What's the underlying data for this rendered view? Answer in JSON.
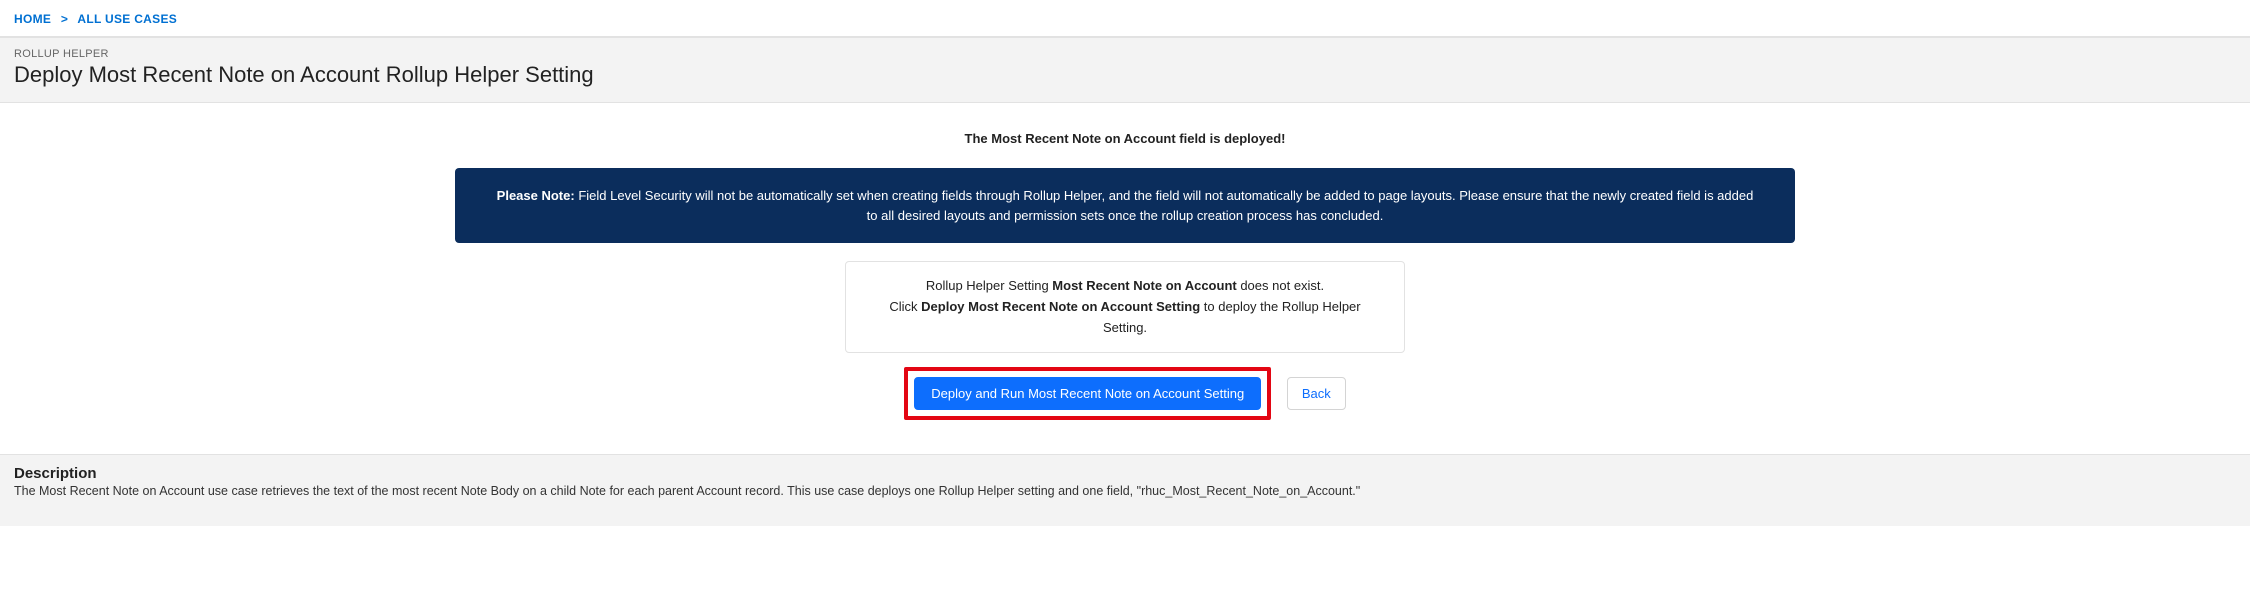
{
  "breadcrumb": {
    "home": "HOME",
    "sep": ">",
    "all": "ALL USE CASES"
  },
  "header": {
    "eyebrow": "ROLLUP HELPER",
    "title": "Deploy Most Recent Note on Account Rollup Helper Setting"
  },
  "status": "The Most Recent Note on Account field is deployed!",
  "note": {
    "lead": "Please Note:",
    "body": " Field Level Security will not be automatically set when creating fields through Rollup Helper, and the field will not automatically be added to page layouts. Please ensure that the newly created field is added to all desired layouts and permission sets once the rollup creation process has concluded."
  },
  "card": {
    "line1_pre": "Rollup Helper Setting ",
    "line1_bold": "Most Recent Note on Account",
    "line1_post": " does not exist.",
    "line2_pre": "Click ",
    "line2_bold": "Deploy Most Recent Note on Account Setting",
    "line2_post": " to deploy the Rollup Helper Setting."
  },
  "buttons": {
    "deploy": "Deploy and Run Most Recent Note on Account Setting",
    "back": "Back"
  },
  "description": {
    "heading": "Description",
    "body": "The Most Recent Note on Account use case retrieves the text of the most recent Note Body on a child Note for each parent Account record. This use case deploys one Rollup Helper setting and one field, \"rhuc_Most_Recent_Note_on_Account.\""
  }
}
